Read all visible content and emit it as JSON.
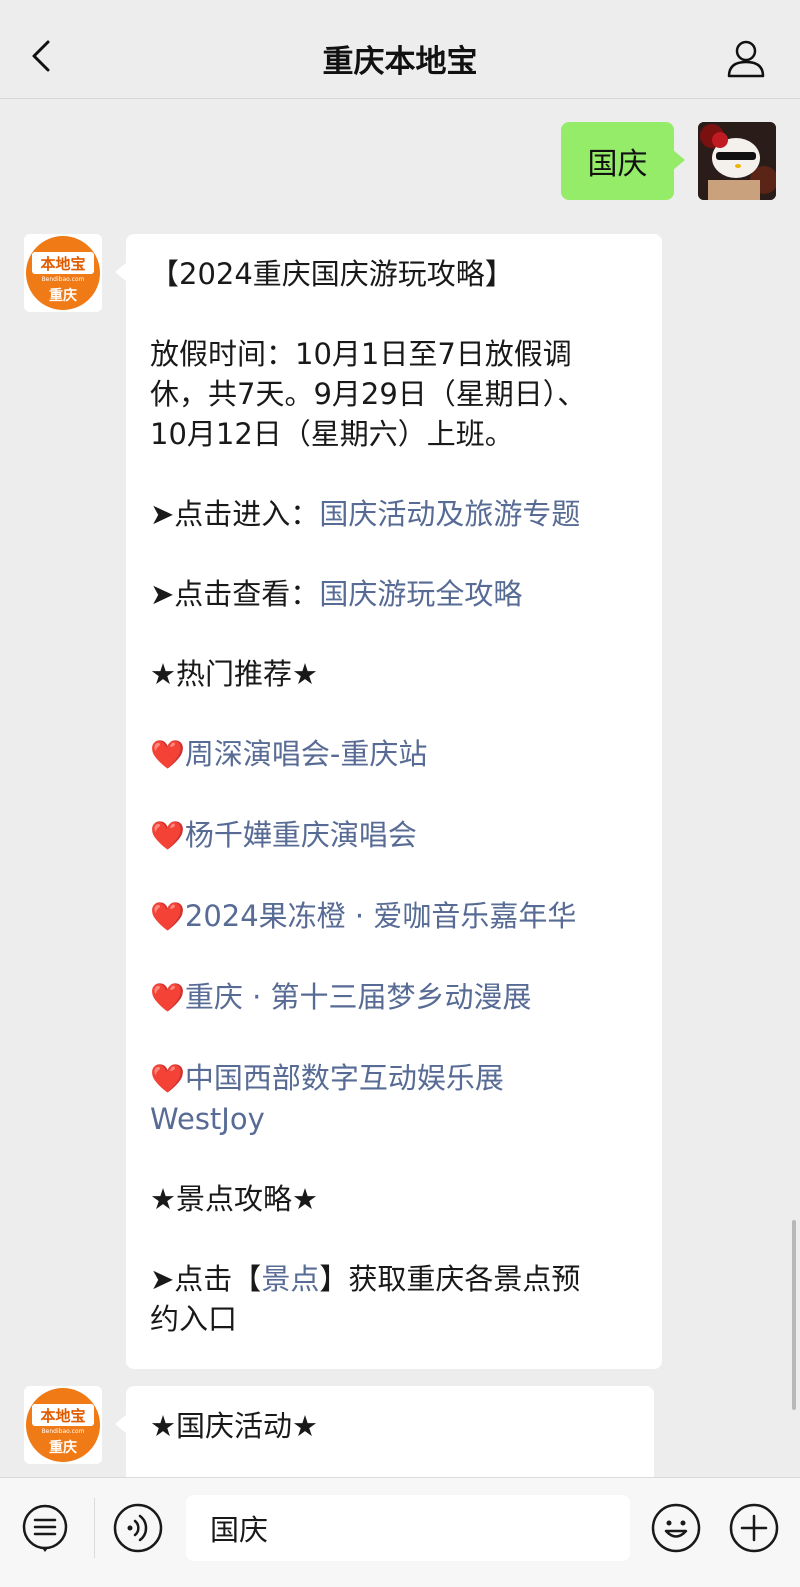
{
  "header": {
    "title": "重庆本地宝"
  },
  "outgoing": {
    "text": "国庆"
  },
  "bot": {
    "logo_top": "本地宝",
    "logo_sub": "Bendibao.com",
    "logo_bottom": "重庆"
  },
  "message1": {
    "title": "【2024重庆国庆游玩攻略】",
    "holiday_line1": "放假时间：10月1日至7日放假调",
    "holiday_line2": "休，共7天。9月29日（星期日）、",
    "holiday_line3": "10月12日（星期六）上班。",
    "enter_prefix": "➤点击进入：",
    "enter_link": "国庆活动及旅游专题",
    "view_prefix": "➤点击查看：",
    "view_link": "国庆游玩全攻略",
    "hot_heading": "★热门推荐★",
    "heart": "❤️",
    "hot_items": [
      "周深演唱会-重庆站",
      "杨千嬅重庆演唱会",
      "2024果冻橙 · 爱咖音乐嘉年华",
      "重庆 · 第十三届梦乡动漫展",
      "中国西部数字互动娱乐展",
      "WestJoy"
    ],
    "spots_heading": "★景点攻略★",
    "spots_prefix": "➤点击【",
    "spots_link": "景点",
    "spots_suffix": "】获取重庆各景点预",
    "spots_line2": "约入口"
  },
  "message2": {
    "heading": "★国庆活动★"
  },
  "input": {
    "value": "国庆"
  },
  "colors": {
    "bubble_out": "#95ec69",
    "link": "#576b95",
    "background": "#ededed",
    "logo_orange": "#f07a16"
  }
}
